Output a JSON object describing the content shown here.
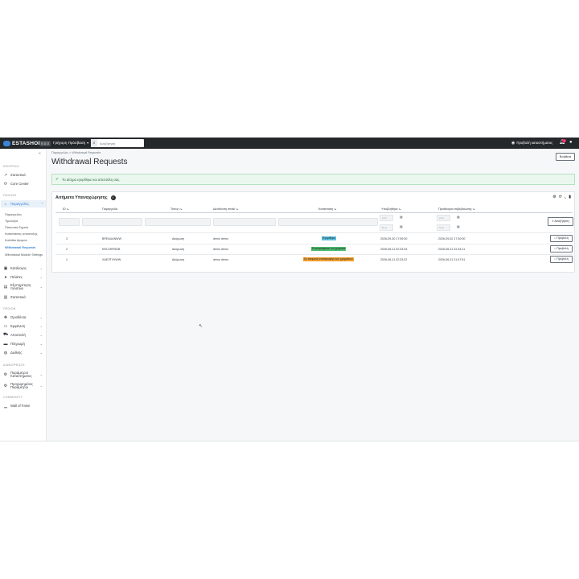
{
  "topbar": {
    "brand": "PRESTASHOP",
    "brand_short": "ESTASHOP",
    "version": "9.0.0",
    "quick_access": "Γρήγορη Πρόσβαση",
    "search_placeholder": "Αναζήτηση",
    "view_store": "Προβολή καταστήματος",
    "notifications_count": "1"
  },
  "sidebar": {
    "sections": [
      "ΚΕΝΤΡΙΚΑ",
      "ΠΩΛΗΣΗ",
      "ΠΡΟΙΟΝ",
      "ΔΙΑΜΟΡΦΩΣΗ",
      "COMMUNITY"
    ],
    "items": [
      {
        "label": "Στατιστικά",
        "icon": "trending-up-icon"
      },
      {
        "label": "Core Center",
        "icon": "refresh-icon"
      },
      {
        "label": "Παραγγελίες",
        "icon": "shopping-basket-icon"
      },
      {
        "label": "Κατάλογος",
        "icon": "store-icon"
      },
      {
        "label": "Πελάτες",
        "icon": "account-icon"
      },
      {
        "label": "Εξυπηρέτηση πελατών",
        "icon": "chat-icon"
      },
      {
        "label": "Στατιστικά",
        "icon": "bar-chart-icon"
      },
      {
        "label": "Ορισθέντα",
        "icon": "puzzle-icon"
      },
      {
        "label": "Εμφάνιση",
        "icon": "desktop-icon"
      },
      {
        "label": "Αποστολή",
        "icon": "truck-icon"
      },
      {
        "label": "Πληρωμή",
        "icon": "credit-card-icon"
      },
      {
        "label": "Διεθνής",
        "icon": "globe-icon"
      },
      {
        "label": "Παράμετροι Καταστήματος",
        "icon": "settings-icon"
      },
      {
        "label": "Προχωρημένες Παράμετροι",
        "icon": "settings-applications-icon"
      },
      {
        "label": "Wall of Fame",
        "icon": "chart-icon"
      }
    ],
    "subitems": [
      "Παραγγελίες",
      "Τιμολόγια",
      "Πιστωτικά Σημεία",
      "Καταστάσεις αποστολής",
      "Καλάθια Αγορών",
      "Withdrawal Requests",
      "Withdrawal Module Settings"
    ]
  },
  "main": {
    "breadcrumb": "Παραγγελίες  >  Withdrawal Requests",
    "title": "Withdrawal Requests",
    "help_label": "Βοήθεια",
    "alert_text": "Το αίτημα εγκρίθηκε και απεστάλη σας.",
    "panel_title": "Αιτήματα Υπαναχώρησης",
    "columns": [
      "ID",
      "Παραγγελία",
      "Τύπος",
      "Διεύθυνση email",
      "Κατάσταση",
      "Υποβλήθηκε",
      "Προθεσμία επιβεβαίωσης"
    ],
    "date_from": "Από",
    "date_to": "Έως",
    "search_label": "Αναζήτηση",
    "view_label": "Προβολή",
    "rows": [
      {
        "id": "3",
        "order": "ВРЕAUANWW",
        "type": "Ακύρωση",
        "email": "demo demo",
        "status": "Εγκρίθηκε",
        "submitted": "2026-09-30 17:59:30",
        "deadline": "2026-09-02 17:30:00",
        "status_color": "#5bc0de"
      },
      {
        "id": "2",
        "order": "KRLGHRSDB",
        "type": "Ακύρωση",
        "email": "demo demo",
        "status": "Επιστράφηκαν τα χρήματα",
        "submitted": "2026-06-11 22:33:34",
        "deadline": "2026-06-21 22:34:11",
        "status_color": "#4cbb6c"
      },
      {
        "id": "1",
        "order": "ХАЕЛТУХWW",
        "type": "Ακύρωση",
        "email": "demo demo",
        "status": "Σε αναμονή επιστροφής των χρημάτων",
        "submitted": "2026-06-11 22:33:22",
        "deadline": "2026-06-21 21:47:51",
        "status_color": "#f0a030"
      }
    ]
  }
}
